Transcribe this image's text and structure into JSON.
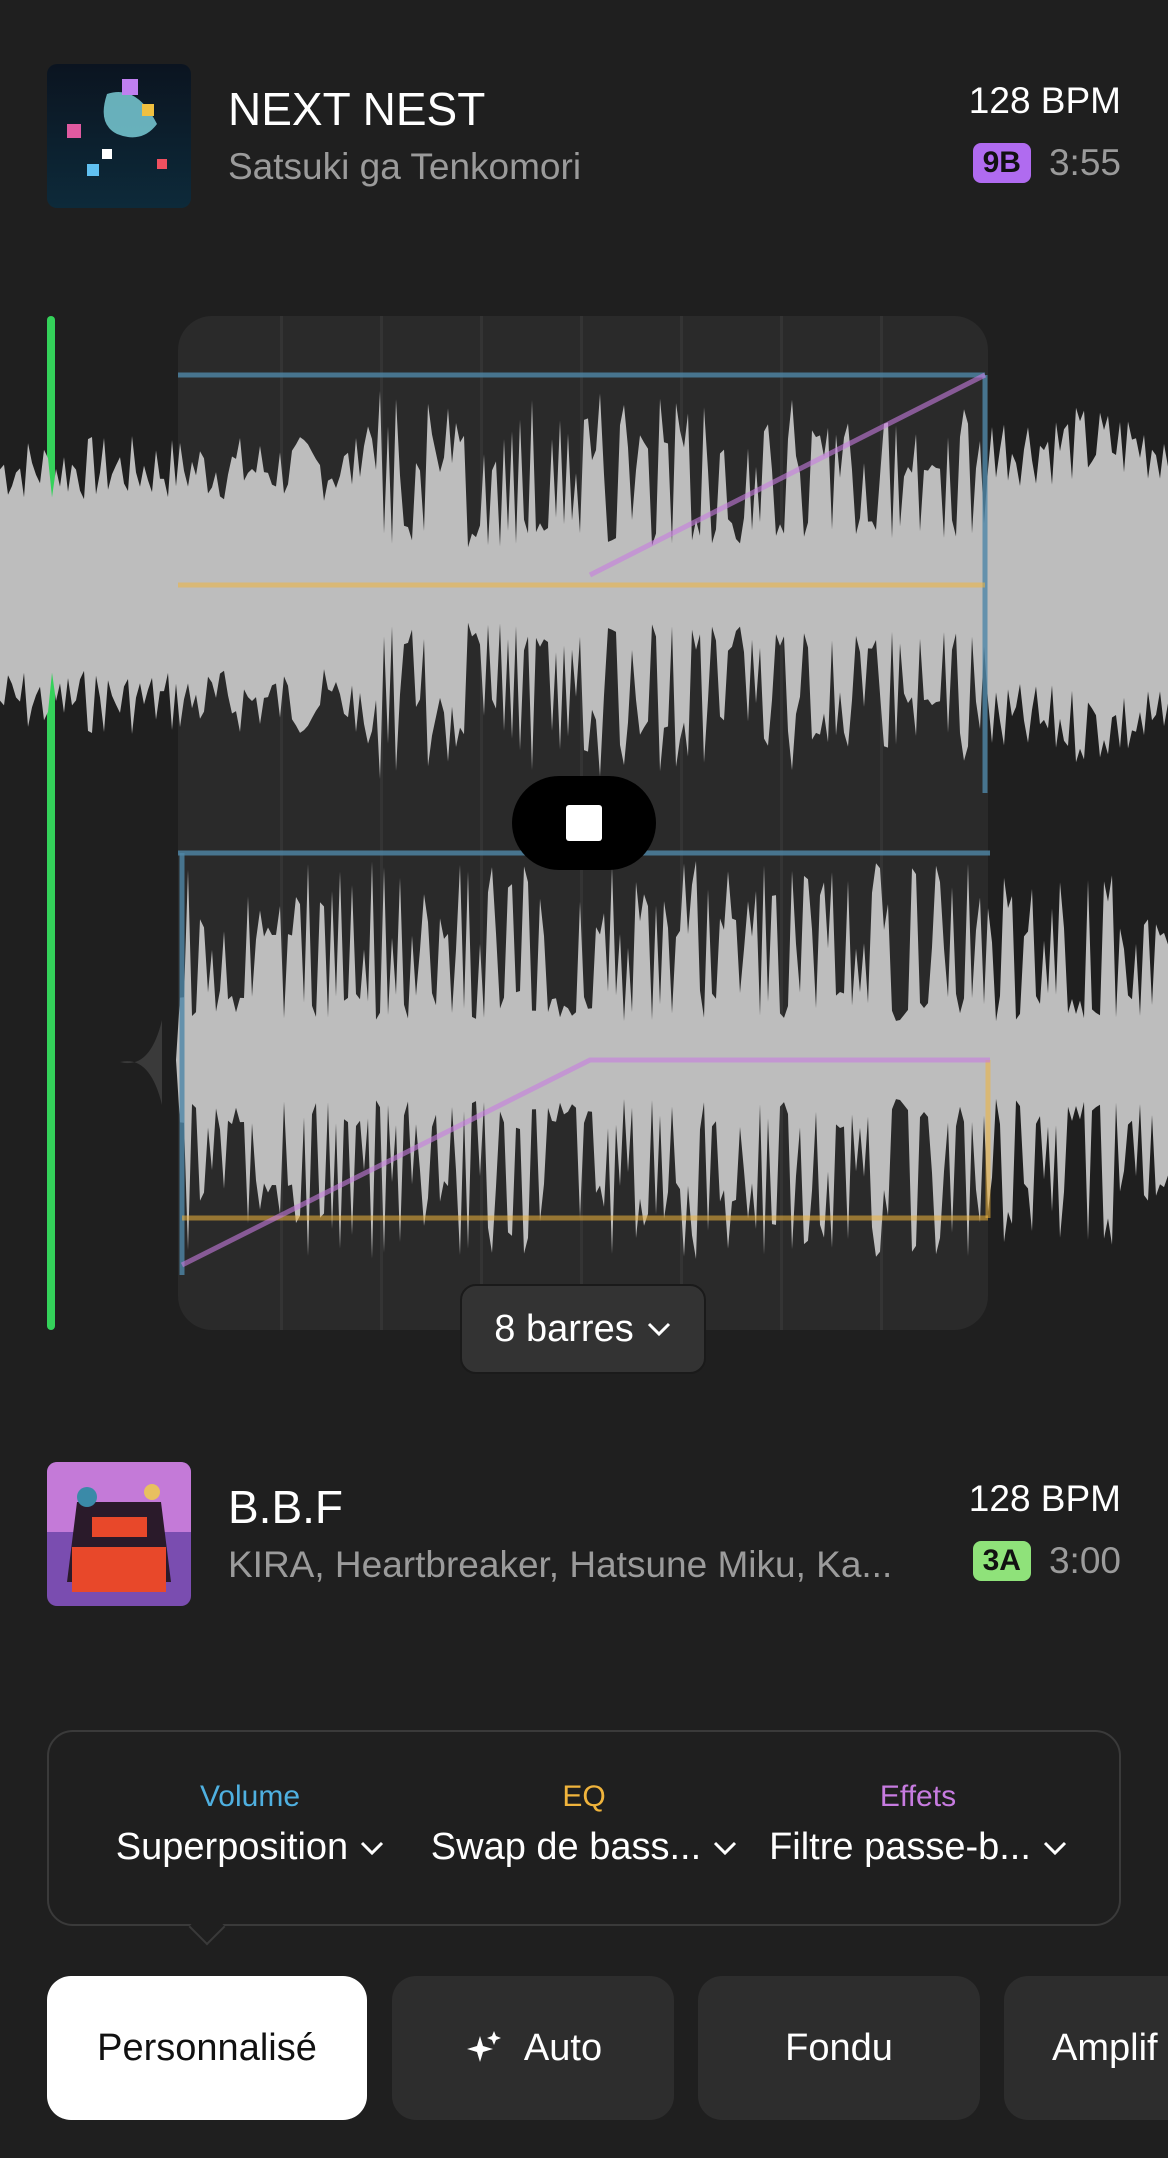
{
  "track_top": {
    "title": "NEXT NEST",
    "artist": "Satsuki ga Tenkomori",
    "bpm": "128 BPM",
    "key": "9B",
    "key_color": "#b06bf0",
    "duration": "3:55"
  },
  "track_bottom": {
    "title": "B.B.F",
    "artist": "KIRA, Heartbreaker, Hatsune Miku, Ka...",
    "bpm": "128 BPM",
    "key": "3A",
    "key_color": "#8fe27a",
    "duration": "3:00"
  },
  "transition": {
    "length_label": "8 barres",
    "playhead_color": "#34d15a"
  },
  "controls": {
    "volume": {
      "label": "Volume",
      "value": "Superposition",
      "color": "#4fb0e0"
    },
    "eq": {
      "label": "EQ",
      "value": "Swap de bass...",
      "color": "#f0b43c"
    },
    "effects": {
      "label": "Effets",
      "value": "Filtre passe-b...",
      "color": "#c77be0"
    }
  },
  "presets": [
    {
      "label": "Personnalisé",
      "active": true
    },
    {
      "label": "Auto",
      "icon": "sparkle-icon"
    },
    {
      "label": "Fondu"
    },
    {
      "label": "Amplif"
    }
  ]
}
